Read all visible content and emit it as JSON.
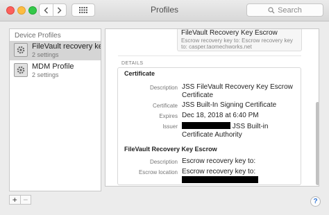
{
  "window": {
    "title": "Profiles"
  },
  "search": {
    "placeholder": "Search"
  },
  "sidebar": {
    "header": "Device Profiles",
    "items": [
      {
        "name": "FileVault recovery key re",
        "subtitle": "2 settings",
        "selected": true
      },
      {
        "name": "MDM Profile",
        "subtitle": "2 settings",
        "selected": false
      }
    ],
    "add_label": "+",
    "remove_label": "−"
  },
  "detail": {
    "top_card": {
      "title": "FileVault Recovery Key Escrow",
      "description": "Escrow recovery key to: Escrow recovery key to: casper.taomechworks.net"
    },
    "section_header": "DETAILS",
    "certificate": {
      "title": "Certificate",
      "rows": [
        {
          "label": "Description",
          "value": "JSS FileVault Recovery Key Escrow Certificate"
        },
        {
          "label": "Certificate",
          "value": "JSS Built-In Signing Certificate"
        },
        {
          "label": "Expires",
          "value": "Dec 18, 2018 at 6:40 PM"
        },
        {
          "label": "Issuer",
          "value": "JSS Built-in Certificate Authority"
        }
      ]
    },
    "escrow": {
      "title": "FileVault Recovery Key Escrow",
      "rows": [
        {
          "label": "Description",
          "value": "Escrow recovery key to:"
        },
        {
          "label": "Escrow location",
          "value": "Escrow recovery key to:"
        }
      ]
    }
  },
  "help": {
    "label": "?"
  },
  "colors": {
    "selected_row": "#d5d5d5",
    "accent": "#2f74d6",
    "redaction": "#000000"
  }
}
